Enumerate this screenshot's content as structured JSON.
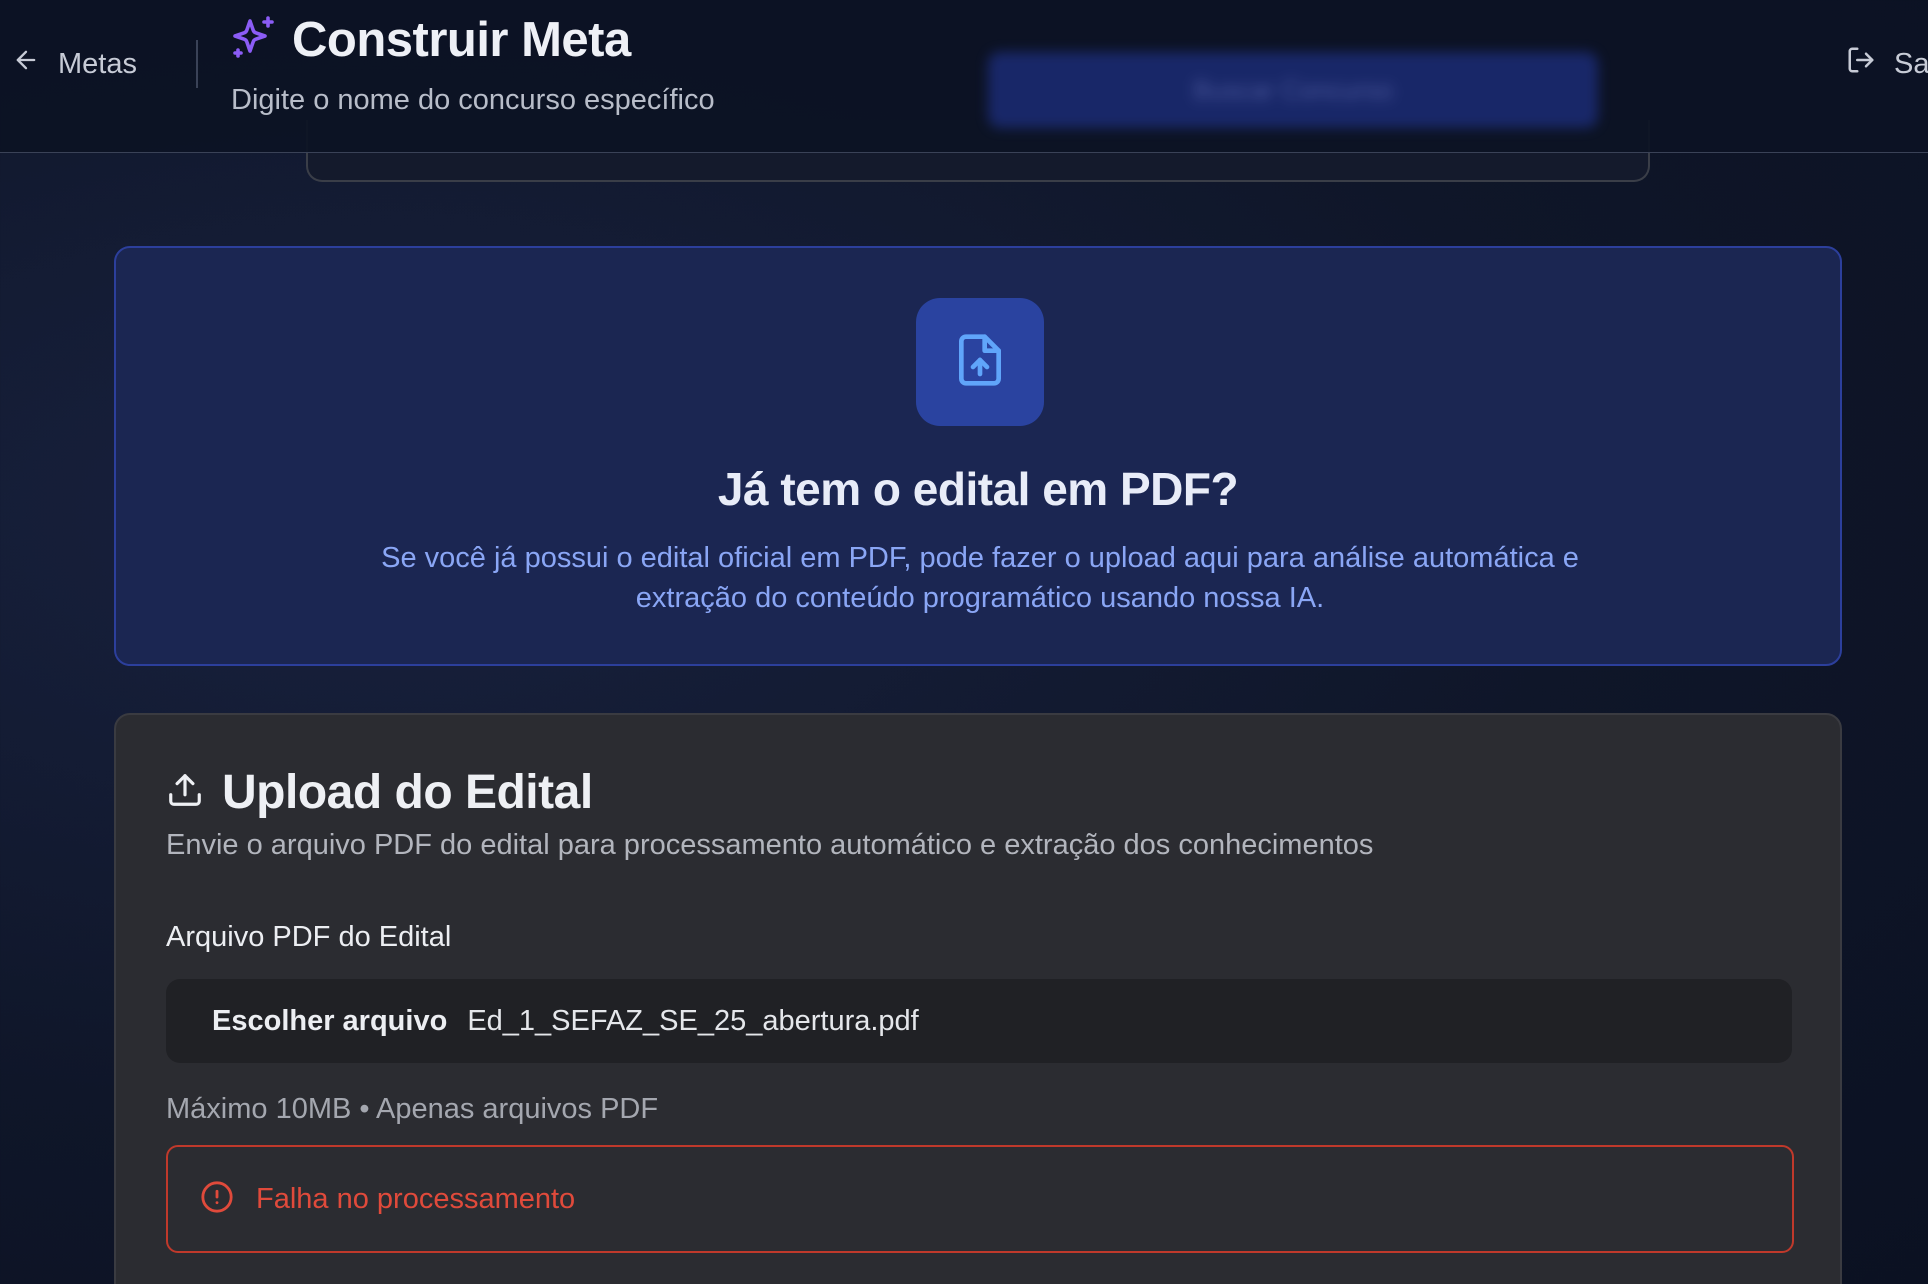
{
  "header": {
    "back_label": "Metas",
    "title": "Construir Meta",
    "subtitle": "Digite o nome do concurso específico",
    "blurred_button_label": "Buscar Concurso",
    "logout_label": "Sair",
    "title_icon_color": "#8b5cf6"
  },
  "info_card": {
    "heading": "Já tem o edital em PDF?",
    "text": "Se você já possui o edital oficial em PDF, pode fazer o upload aqui para análise automática e extração do conteúdo programático usando nossa IA.",
    "icon": "file-upload-icon",
    "accent": "#60a5fa"
  },
  "upload_card": {
    "title": "Upload do Edital",
    "description": "Envie o arquivo PDF do edital para processamento automático e extração dos conhecimentos",
    "field_label": "Arquivo PDF do Edital",
    "choose_file_label": "Escolher arquivo",
    "file_name": "Ed_1_SEFAZ_SE_25_abertura.pdf",
    "hint": "Máximo 10MB • Apenas arquivos PDF",
    "error_message": "Falha no processamento",
    "error_color": "#e04a3b"
  }
}
